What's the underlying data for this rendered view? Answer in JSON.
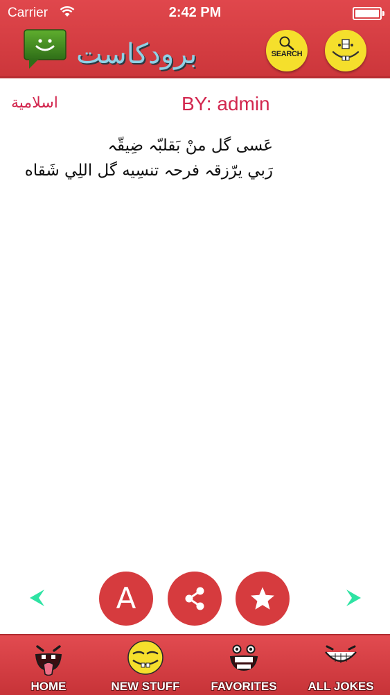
{
  "status_bar": {
    "carrier": "Carrier",
    "time": "2:42 PM"
  },
  "header": {
    "app_title": "برودكاست",
    "logo_icon": "chat-smile-icon",
    "search_label": "SEARCH",
    "menu_icon": "smiley-menu-icon"
  },
  "joke": {
    "category": "اسلامية",
    "author": "BY: admin",
    "lines": [
      "عَسى گل منْ بَقلبّہ ضِيقّہ",
      "رَبي يرّزقہ فرحہ تنسِيه گل اللِي شَقاه"
    ]
  },
  "actions": {
    "font_label": "A",
    "prev_icon": "arrow-left-icon",
    "next_icon": "arrow-right-icon",
    "share_icon": "share-icon",
    "favorite_icon": "star-icon"
  },
  "tabs": [
    {
      "label": "HOME",
      "icon": "laughing-face-icon"
    },
    {
      "label": "NEW STUFF",
      "icon": "yellow-smiley-icon"
    },
    {
      "label": "FAVORITES",
      "icon": "grinning-face-icon"
    },
    {
      "label": "ALL JOKES",
      "icon": "big-grin-icon"
    }
  ],
  "colors": {
    "header_red": "#d63b3e",
    "accent_red": "#d2264e",
    "arrow_teal": "#2ee3a3",
    "smiley_yellow": "#f5df2c"
  }
}
